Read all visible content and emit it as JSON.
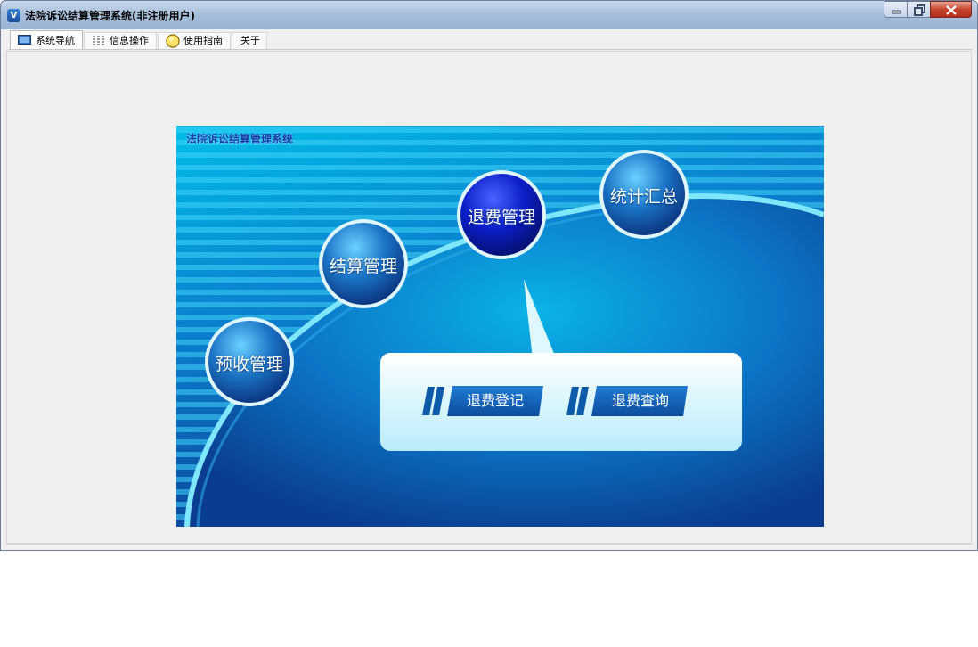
{
  "window": {
    "title": "法院诉讼结算管理系统(非注册用户)"
  },
  "tabs": [
    {
      "label": "系统导航",
      "icon": "monitor-icon"
    },
    {
      "label": "信息操作",
      "icon": "grid-icon"
    },
    {
      "label": "使用指南",
      "icon": "lightbulb-icon"
    },
    {
      "label": "关于",
      "icon": ""
    }
  ],
  "banner": {
    "title": "法院诉讼结算管理系统",
    "modules": [
      {
        "label": "预收管理"
      },
      {
        "label": "结算管理"
      },
      {
        "label": "退费管理"
      },
      {
        "label": "统计汇总"
      }
    ],
    "submenu": [
      {
        "label": "退费登记"
      },
      {
        "label": "退费查询"
      }
    ]
  },
  "colors": {
    "title_bar": "#a9c0dc",
    "banner_dark": "#0a3e8c",
    "banner_light": "#00b3e6",
    "active_circle": "#0a1fc9"
  }
}
